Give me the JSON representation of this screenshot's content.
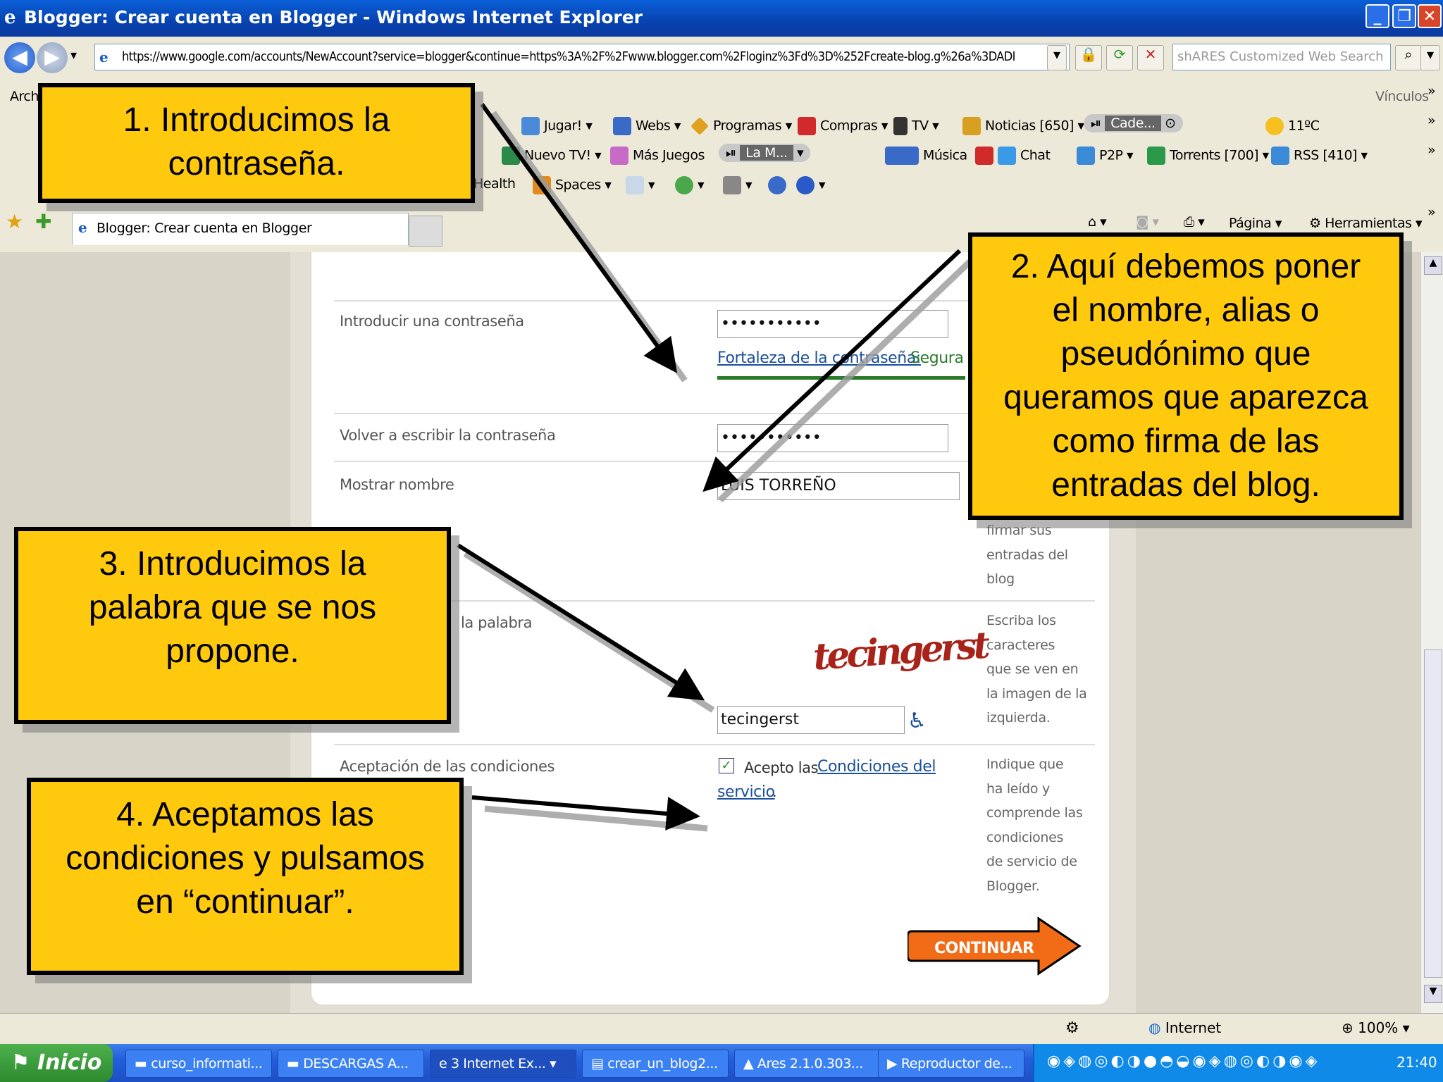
{
  "window": {
    "title": "Blogger: Crear cuenta en Blogger - Windows Internet Explorer"
  },
  "address_bar": {
    "url": "https://www.google.com/accounts/NewAccount?service=blogger&continue=https%3A%2F%2Fwww.blogger.com%2Floginz%3Fd%3D%252Fcreate-blog.g%26a%3DADI",
    "search_placeholder": "shARES Customized Web Search"
  },
  "toolbars": {
    "archivo": "Archi",
    "vinculos": "Vínculos",
    "row1": [
      "Jugar!",
      "Webs",
      "Programas",
      "Compras",
      "TV",
      "Noticias [650]",
      "Cade...",
      "11ºC"
    ],
    "row2": [
      "Nuevo TV!",
      "Más Juegos",
      "La M...",
      "Música",
      "Chat",
      "P2P",
      "Torrents [700]",
      "RSS [410]"
    ],
    "row3": [
      "Health",
      "Spaces"
    ],
    "command": [
      "Página",
      "Herramientas"
    ]
  },
  "tab": {
    "label": "Blogger: Crear cuenta en Blogger"
  },
  "form": {
    "password_label": "Introducir una contraseña",
    "password_value": "•••••••••••",
    "strength_link": "Fortaleza de la contraseña:",
    "strength_value": "Segura",
    "repeat_label": "Volver a escribir la contraseña",
    "repeat_value": "•••••••••••",
    "display_name_label": "Mostrar nombre",
    "display_name_value": "LUIS TORREÑO",
    "display_name_help": [
      "firmar sus",
      "entradas del",
      "blog"
    ],
    "word_label": "la palabra",
    "captcha_word": "tecingerst",
    "word_value": "tecingerst",
    "word_help": [
      "Escriba los",
      "caracteres",
      "que se ven en",
      "la imagen de la",
      "izquierda."
    ],
    "terms_label": "Aceptación de las condiciones",
    "terms_checkbox_text": "Acepto las ",
    "terms_link_1": "Condiciones del",
    "terms_link_2": "servicio",
    "terms_period": ".",
    "terms_help": [
      "Indique que",
      "ha leído y",
      "comprende las",
      "condiciones",
      "de servicio de",
      "Blogger."
    ],
    "continue_button": "CONTINUAR"
  },
  "callouts": {
    "c1": [
      "1. Introducimos la",
      "contraseña."
    ],
    "c2": [
      "2. Aquí debemos poner",
      "el nombre, alias o",
      "pseudónimo que",
      "queramos que aparezca",
      "como firma de las",
      "entradas del blog."
    ],
    "c3": [
      "3. Introducimos la",
      "palabra que se nos",
      "propone."
    ],
    "c4": [
      "4. Aceptamos las",
      "condiciones y pulsamos",
      "en “continuar”."
    ]
  },
  "status_bar": {
    "zone": "Internet",
    "zoom": "100%"
  },
  "taskbar": {
    "start": "Inicio",
    "tasks": [
      "curso_informati...",
      "DESCARGAS A...",
      "3 Internet Ex...",
      "crear_un_blog2...",
      "Ares 2.1.0.303...",
      "Reproductor de..."
    ],
    "clock": "21:40"
  },
  "colors": {
    "callout": "#ffc90e",
    "link": "#1a4f9c",
    "strength": "#2a7a2a",
    "continue": "#f26b16"
  }
}
